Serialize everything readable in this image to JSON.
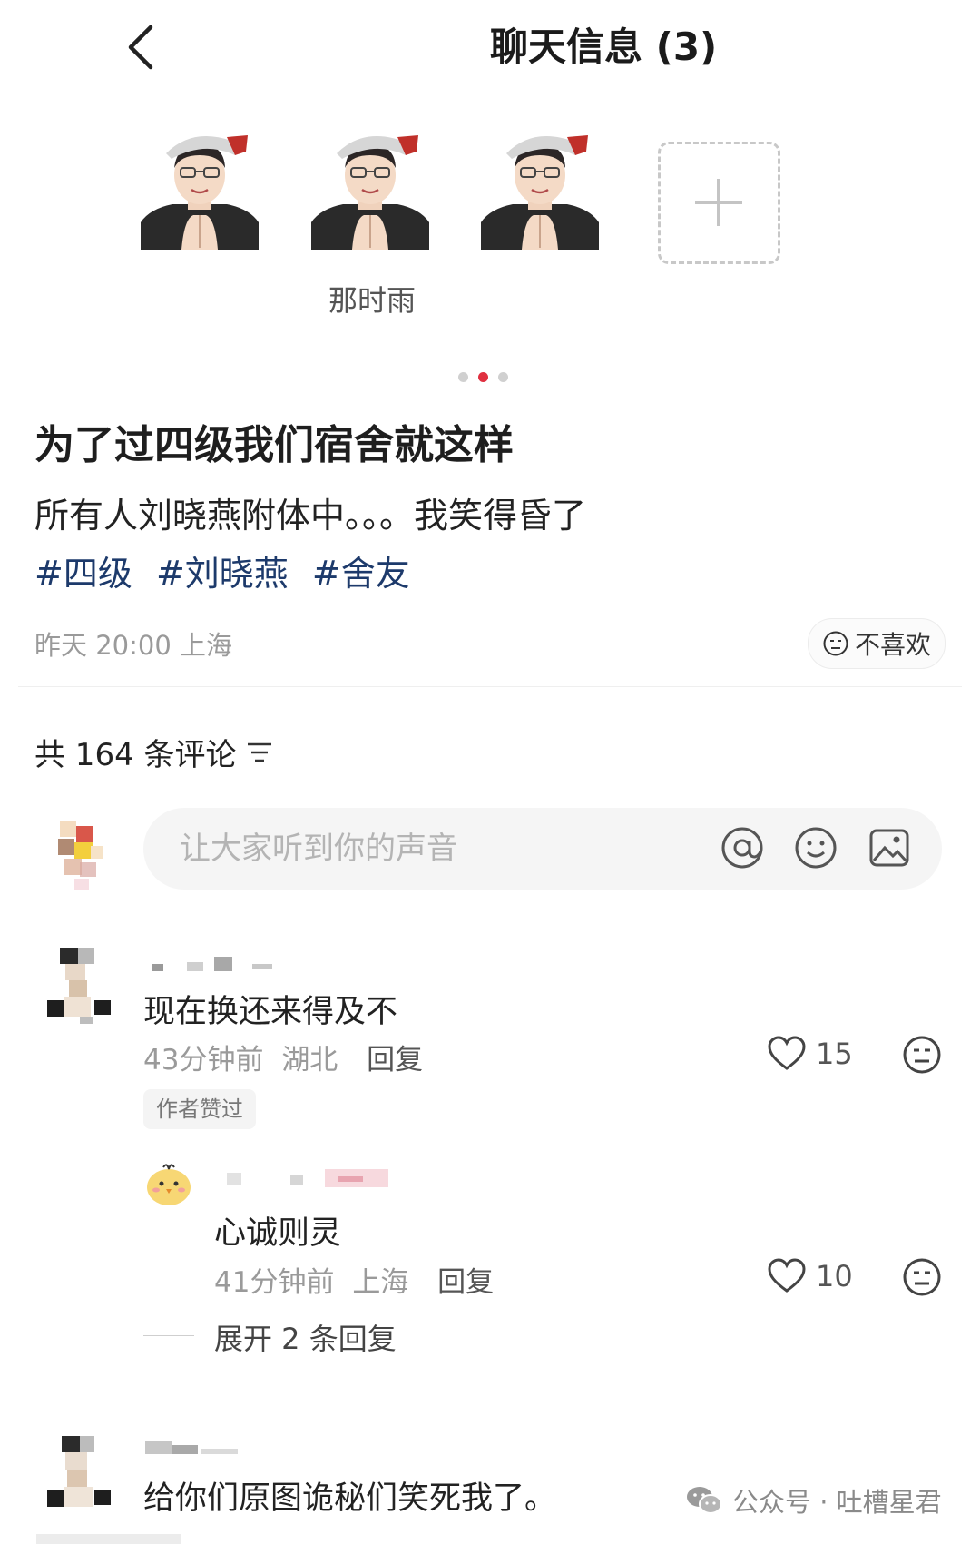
{
  "header": {
    "title": "聊天信息 (3)",
    "back_icon": "chevron-left-icon"
  },
  "gallery": {
    "caption": "那时雨",
    "add_icon": "plus-icon",
    "active_dot_color": "#e03040",
    "dot_color": "#d0d0d0"
  },
  "post": {
    "title": "为了过四级我们宿舍就这样",
    "body": "所有人刘晓燕附体中。。。我笑得昏了",
    "tags": [
      "#四级",
      "#刘晓燕",
      "#舍友"
    ],
    "tag_color": "#1d3a6b",
    "meta": "昨天 20:00 上海",
    "dislike_label": "不喜欢"
  },
  "comments_header": {
    "label": "共 164 条评论",
    "sort_icon": "filter-lines-icon"
  },
  "comment_input": {
    "placeholder": "让大家听到你的声音",
    "icons": [
      "at-icon",
      "emoji-icon",
      "image-icon"
    ]
  },
  "comments": [
    {
      "text": "现在换还来得及不",
      "time": "43分钟前",
      "location": "湖北",
      "reply_label": "回复",
      "likes": "15",
      "badge": "作者赞过"
    },
    {
      "text": "给你们原图诡秘们笑死我了。"
    }
  ],
  "replies": [
    {
      "text": "心诚则灵",
      "time": "41分钟前",
      "location": "上海",
      "reply_label": "回复",
      "likes": "10"
    }
  ],
  "expand": {
    "label": "展开 2 条回复"
  },
  "watermark": {
    "label": "公众号 · 吐槽星君",
    "icon": "wechat-icon"
  }
}
